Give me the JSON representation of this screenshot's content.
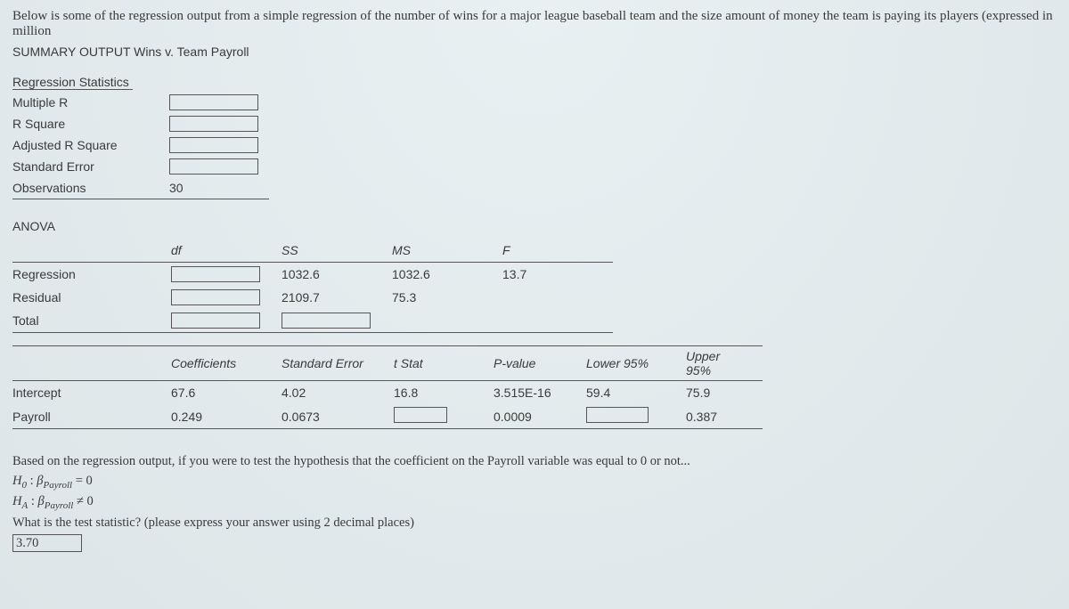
{
  "intro": "Below is some of the regression output from a simple regression of the number of wins for a major league baseball team and the size amount of money the team is paying its players (expressed in million",
  "summary_title": "SUMMARY OUTPUT Wins v. Team Payroll",
  "reg_stats_title": "Regression Statistics",
  "stats": {
    "multiple_r_label": "Multiple R",
    "r_square_label": "R Square",
    "adj_r_square_label": "Adjusted R Square",
    "std_error_label": "Standard Error",
    "observations_label": "Observations",
    "observations_value": "30"
  },
  "anova_title": "ANOVA",
  "anova_headers": {
    "df": "df",
    "ss": "SS",
    "ms": "MS",
    "f": "F"
  },
  "anova": {
    "regression_label": "Regression",
    "regression": {
      "ss": "1032.6",
      "ms": "1032.6",
      "f": "13.7"
    },
    "residual_label": "Residual",
    "residual": {
      "ss": "2109.7",
      "ms": "75.3"
    },
    "total_label": "Total"
  },
  "coef_headers": {
    "coef": "Coefficients",
    "se": "Standard Error",
    "t": "t Stat",
    "p": "P-value",
    "l95": "Lower 95%",
    "u95a": "Upper",
    "u95b": "95%"
  },
  "coef": {
    "intercept_label": "Intercept",
    "intercept": {
      "coef": "67.6",
      "se": "4.02",
      "t": "16.8",
      "p": "3.515E-16",
      "l95": "59.4",
      "u95": "75.9"
    },
    "payroll_label": "Payroll",
    "payroll": {
      "coef": "0.249",
      "se": "0.0673",
      "p": "0.0009",
      "u95": "0.387"
    }
  },
  "question": {
    "line1": "Based on the regression output, if you were to test the hypothesis that the coefficient on the Payroll variable was equal to 0 or not...",
    "h0_lhs": "H",
    "h0_sub": "0",
    "colon": " : ",
    "beta": "β",
    "beta_sub": "Payroll",
    "eq0": " = 0",
    "hA_sub": "A",
    "neq0": " ≠ 0",
    "line4": "What is the test statistic? (please express your answer using 2 decimal places)",
    "answer": "3.70"
  }
}
